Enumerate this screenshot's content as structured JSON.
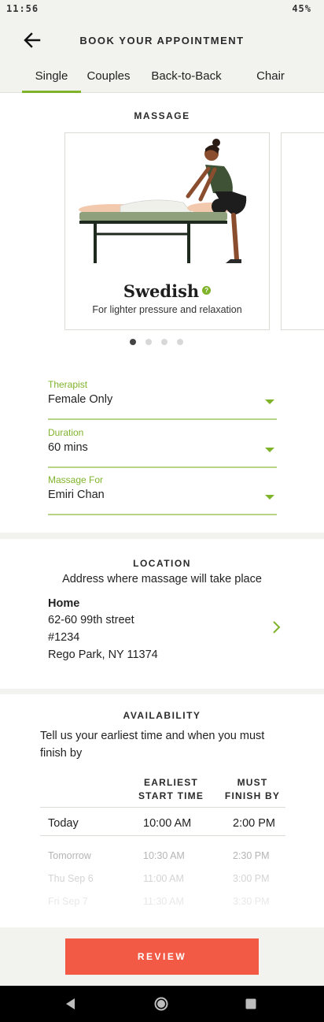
{
  "status": {
    "time": "11:56",
    "battery": "45%"
  },
  "header": {
    "title": "BOOK YOUR APPOINTMENT"
  },
  "tabs": [
    {
      "label": "Single",
      "active": true
    },
    {
      "label": "Couples",
      "active": false
    },
    {
      "label": "Back-to-Back",
      "active": false
    },
    {
      "label": "Chair",
      "active": false
    }
  ],
  "massage": {
    "section_title": "MASSAGE",
    "selected": {
      "name": "Swedish",
      "description": "For lighter pressure and relaxation"
    },
    "carousel_total": 4,
    "carousel_active": 1
  },
  "fields": {
    "therapist": {
      "label": "Therapist",
      "value": "Female Only"
    },
    "duration": {
      "label": "Duration",
      "value": "60 mins"
    },
    "massage_for": {
      "label": "Massage For",
      "value": "Emiri Chan"
    }
  },
  "location": {
    "section_title": "LOCATION",
    "subtitle": "Address where massage will take place",
    "address": {
      "name": "Home",
      "line1": "62-60 99th street",
      "line2": "#1234",
      "line3": "Rego Park, NY 11374"
    }
  },
  "availability": {
    "section_title": "AVAILABILITY",
    "subtitle": "Tell us your earliest time and when you must finish by",
    "col_start": {
      "line1": "EARLIEST",
      "line2": "START TIME"
    },
    "col_end": {
      "line1": "MUST",
      "line2": "FINISH BY"
    },
    "rows": [
      {
        "day": "Today",
        "start": "10:00 AM",
        "end": "2:00 PM"
      },
      {
        "day": "Tomorrow",
        "start": "10:30 AM",
        "end": "2:30 PM"
      },
      {
        "day": "Thu Sep 6",
        "start": "11:00 AM",
        "end": "3:00 PM"
      },
      {
        "day": "Fri Sep 7",
        "start": "11:30 AM",
        "end": "3:30 PM"
      }
    ]
  },
  "review_label": "REVIEW",
  "colors": {
    "accent": "#7fb32a",
    "cta": "#f25a45",
    "background": "#f2f2ee"
  }
}
